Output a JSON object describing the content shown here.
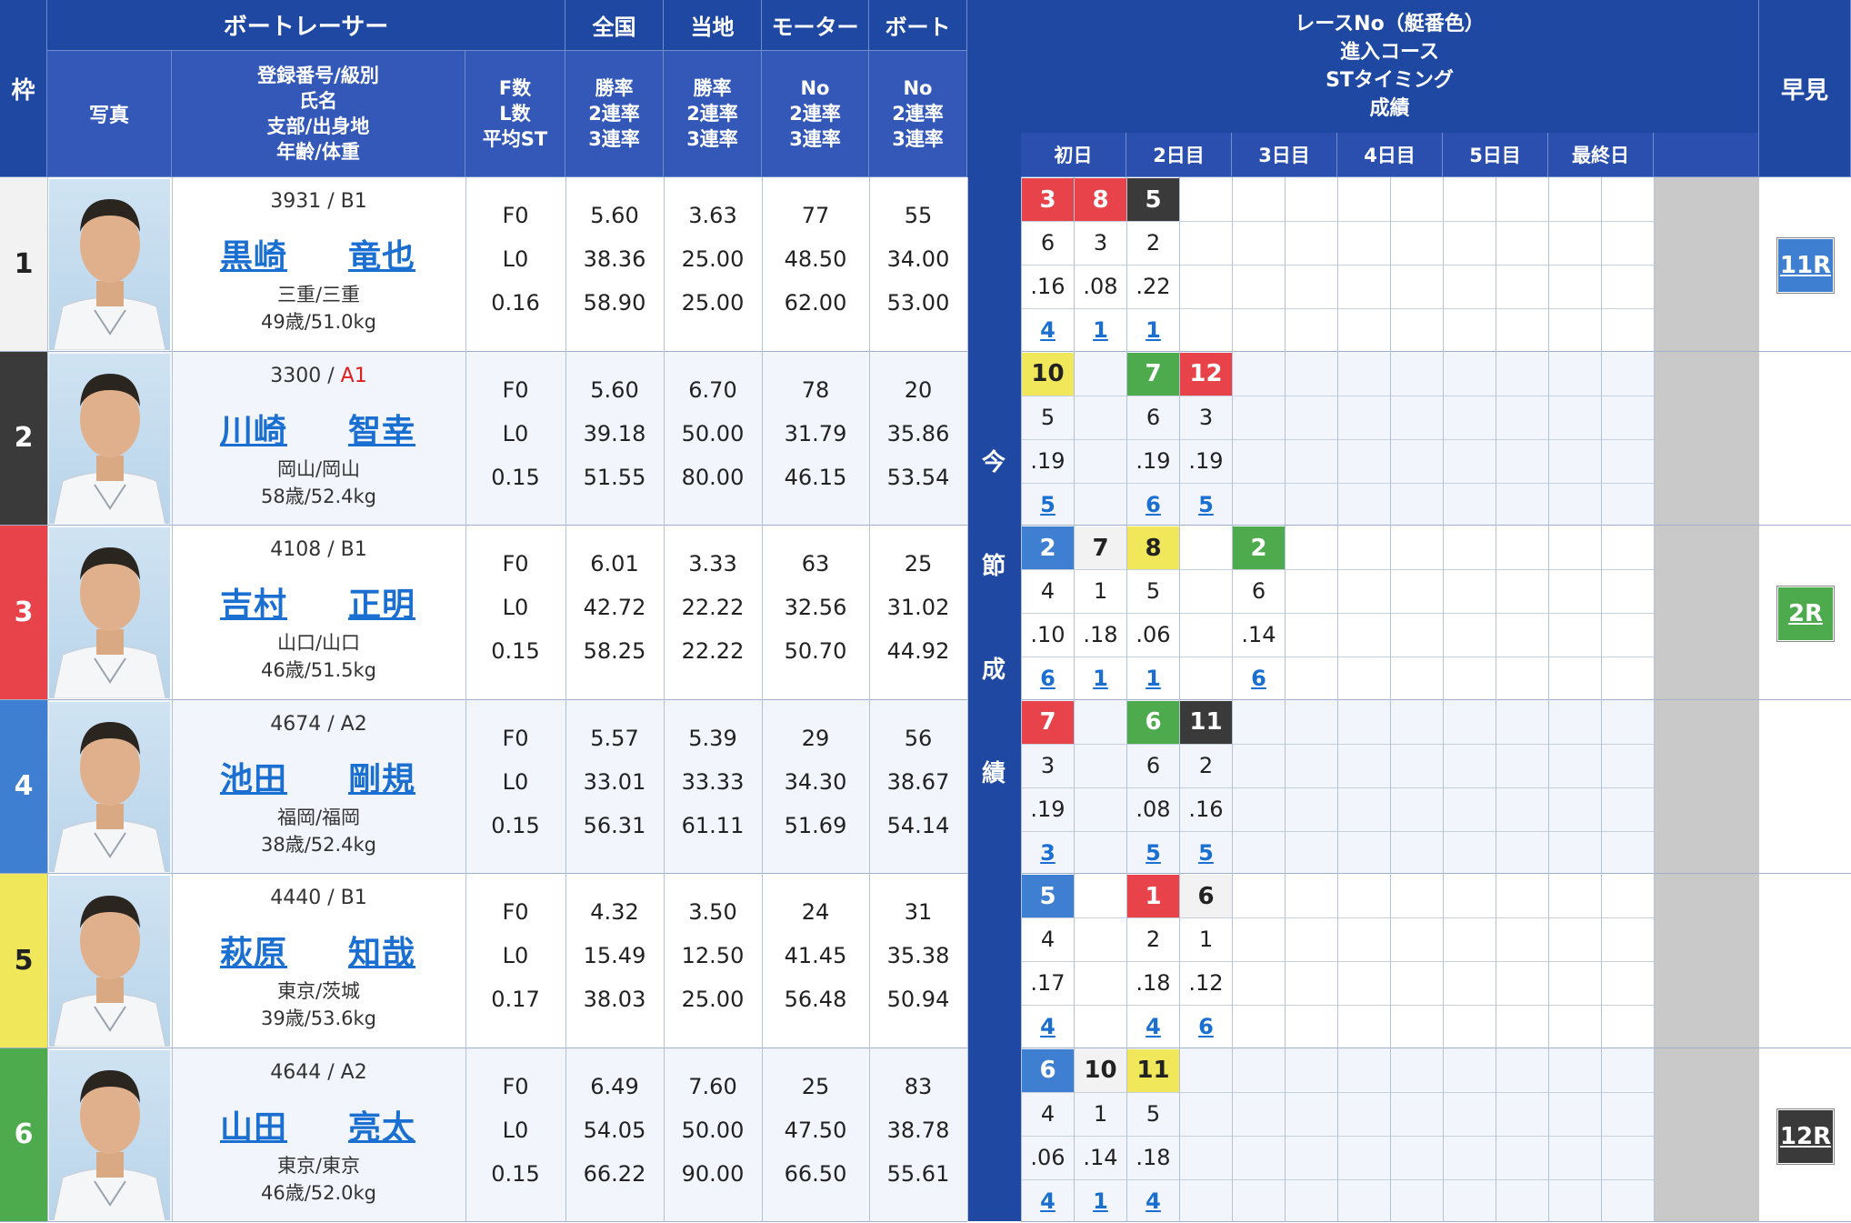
{
  "header": {
    "waku": "枠",
    "racer": "ボートレーサー",
    "photo": "写真",
    "info_lines": [
      "登録番号/級別",
      "氏名",
      "支部/出身地",
      "年齢/体重"
    ],
    "fl_lines": [
      "F数",
      "L数",
      "平均ST"
    ],
    "zenkoku": "全国",
    "touchi": "当地",
    "motor": "モーター",
    "boat": "ボート",
    "rate_lines": [
      "勝率",
      "2連率",
      "3連率"
    ],
    "no_lines": [
      "No",
      "2連率",
      "3連率"
    ],
    "legend_lines": [
      "レースNo（艇番色）",
      "進入コース",
      "STタイミング",
      "成績"
    ],
    "days": [
      "初日",
      "2日目",
      "3日目",
      "4日目",
      "5日目",
      "最終日"
    ],
    "hayami": "早見",
    "konsetsu": [
      "今",
      "節",
      "成",
      "績"
    ]
  },
  "colors": {
    "header_bg": "#1f48a3",
    "waku": [
      "#f2f2f2",
      "#3a3a3a",
      "#e8424a",
      "#3e7fd2",
      "#f0e85a",
      "#4daa4d"
    ],
    "waku_text": [
      "#222",
      "#fff",
      "#fff",
      "#fff",
      "#222",
      "#fff"
    ]
  },
  "racers": [
    {
      "waku": "1",
      "reg": "3931",
      "cls": "B1",
      "last": "黒崎",
      "first": "竜也",
      "branch": "三重/三重",
      "age": "49歳/51.0kg",
      "f": "F0",
      "l": "L0",
      "st": "0.16",
      "z1": "5.60",
      "z2": "38.36",
      "z3": "58.90",
      "t1": "3.63",
      "t2": "25.00",
      "t3": "25.00",
      "m1": "77",
      "m2": "48.50",
      "m3": "62.00",
      "b1": "55",
      "b2": "34.00",
      "b3": "53.00",
      "hayami": "11R"
    },
    {
      "waku": "2",
      "reg": "3300",
      "cls": "A1",
      "last": "川崎",
      "first": "智幸",
      "branch": "岡山/岡山",
      "age": "58歳/52.4kg",
      "f": "F0",
      "l": "L0",
      "st": "0.15",
      "z1": "5.60",
      "z2": "39.18",
      "z3": "51.55",
      "t1": "6.70",
      "t2": "50.00",
      "t3": "80.00",
      "m1": "78",
      "m2": "31.79",
      "m3": "46.15",
      "b1": "20",
      "b2": "35.86",
      "b3": "53.54",
      "hayami": ""
    },
    {
      "waku": "3",
      "reg": "4108",
      "cls": "B1",
      "last": "吉村",
      "first": "正明",
      "branch": "山口/山口",
      "age": "46歳/51.5kg",
      "f": "F0",
      "l": "L0",
      "st": "0.15",
      "z1": "6.01",
      "z2": "42.72",
      "z3": "58.25",
      "t1": "3.33",
      "t2": "22.22",
      "t3": "22.22",
      "m1": "63",
      "m2": "32.56",
      "m3": "50.70",
      "b1": "25",
      "b2": "31.02",
      "b3": "44.92",
      "hayami": "2R"
    },
    {
      "waku": "4",
      "reg": "4674",
      "cls": "A2",
      "last": "池田",
      "first": "剛規",
      "branch": "福岡/福岡",
      "age": "38歳/52.4kg",
      "f": "F0",
      "l": "L0",
      "st": "0.15",
      "z1": "5.57",
      "z2": "33.01",
      "z3": "56.31",
      "t1": "5.39",
      "t2": "33.33",
      "t3": "61.11",
      "m1": "29",
      "m2": "34.30",
      "m3": "51.69",
      "b1": "56",
      "b2": "38.67",
      "b3": "54.14",
      "hayami": ""
    },
    {
      "waku": "5",
      "reg": "4440",
      "cls": "B1",
      "last": "萩原",
      "first": "知哉",
      "branch": "東京/茨城",
      "age": "39歳/53.6kg",
      "f": "F0",
      "l": "L0",
      "st": "0.17",
      "z1": "4.32",
      "z2": "15.49",
      "z3": "38.03",
      "t1": "3.50",
      "t2": "12.50",
      "t3": "25.00",
      "m1": "24",
      "m2": "41.45",
      "m3": "56.48",
      "b1": "31",
      "b2": "35.38",
      "b3": "50.94",
      "hayami": ""
    },
    {
      "waku": "6",
      "reg": "4644",
      "cls": "A2",
      "last": "山田",
      "first": "亮太",
      "branch": "東京/東京",
      "age": "46歳/52.0kg",
      "f": "F0",
      "l": "L0",
      "st": "0.15",
      "z1": "6.49",
      "z2": "54.05",
      "z3": "66.22",
      "t1": "7.60",
      "t2": "50.00",
      "t3": "90.00",
      "m1": "25",
      "m2": "47.50",
      "m3": "66.50",
      "b1": "83",
      "b2": "38.78",
      "b3": "55.61",
      "hayami": "12R"
    }
  ],
  "results": [
    [
      {
        "race": "3",
        "boat": 3,
        "course": "6",
        "st": ".16",
        "rank": "4"
      },
      {
        "race": "8",
        "boat": 3,
        "course": "3",
        "st": ".08",
        "rank": "1"
      },
      {
        "race": "5",
        "boat": 2,
        "course": "2",
        "st": ".22",
        "rank": "1"
      },
      null,
      null,
      null,
      null,
      null,
      null,
      null,
      null,
      null
    ],
    [
      {
        "race": "10",
        "boat": 5,
        "course": "5",
        "st": ".19",
        "rank": "5"
      },
      null,
      {
        "race": "7",
        "boat": 6,
        "course": "6",
        "st": ".19",
        "rank": "6"
      },
      {
        "race": "12",
        "boat": 3,
        "course": "3",
        "st": ".19",
        "rank": "5"
      },
      null,
      null,
      null,
      null,
      null,
      null,
      null,
      null
    ],
    [
      {
        "race": "2",
        "boat": 4,
        "course": "4",
        "st": ".10",
        "rank": "6"
      },
      {
        "race": "7",
        "boat": 1,
        "course": "1",
        "st": ".18",
        "rank": "1"
      },
      {
        "race": "8",
        "boat": 5,
        "course": "5",
        "st": ".06",
        "rank": "1"
      },
      null,
      {
        "race": "2",
        "boat": 6,
        "course": "6",
        "st": ".14",
        "rank": "6"
      },
      null,
      null,
      null,
      null,
      null,
      null,
      null
    ],
    [
      {
        "race": "7",
        "boat": 3,
        "course": "3",
        "st": ".19",
        "rank": "3"
      },
      null,
      {
        "race": "6",
        "boat": 6,
        "course": "6",
        "st": ".08",
        "rank": "5"
      },
      {
        "race": "11",
        "boat": 2,
        "course": "2",
        "st": ".16",
        "rank": "5"
      },
      null,
      null,
      null,
      null,
      null,
      null,
      null,
      null
    ],
    [
      {
        "race": "5",
        "boat": 4,
        "course": "4",
        "st": ".17",
        "rank": "4"
      },
      null,
      {
        "race": "1",
        "boat": 3,
        "course": "2",
        "st": ".18",
        "rank": "4"
      },
      {
        "race": "6",
        "boat": 1,
        "course": "1",
        "st": ".12",
        "rank": "6"
      },
      null,
      null,
      null,
      null,
      null,
      null,
      null,
      null
    ],
    [
      {
        "race": "6",
        "boat": 4,
        "course": "4",
        "st": ".06",
        "rank": "4"
      },
      {
        "race": "10",
        "boat": 1,
        "course": "1",
        "st": ".14",
        "rank": "1"
      },
      {
        "race": "11",
        "boat": 5,
        "course": "5",
        "st": ".18",
        "rank": "4"
      },
      null,
      null,
      null,
      null,
      null,
      null,
      null,
      null,
      null
    ]
  ],
  "hayami_colors": [
    "#3e7fd2",
    "",
    "#4daa4d",
    "",
    "",
    "#3a3a3a"
  ]
}
